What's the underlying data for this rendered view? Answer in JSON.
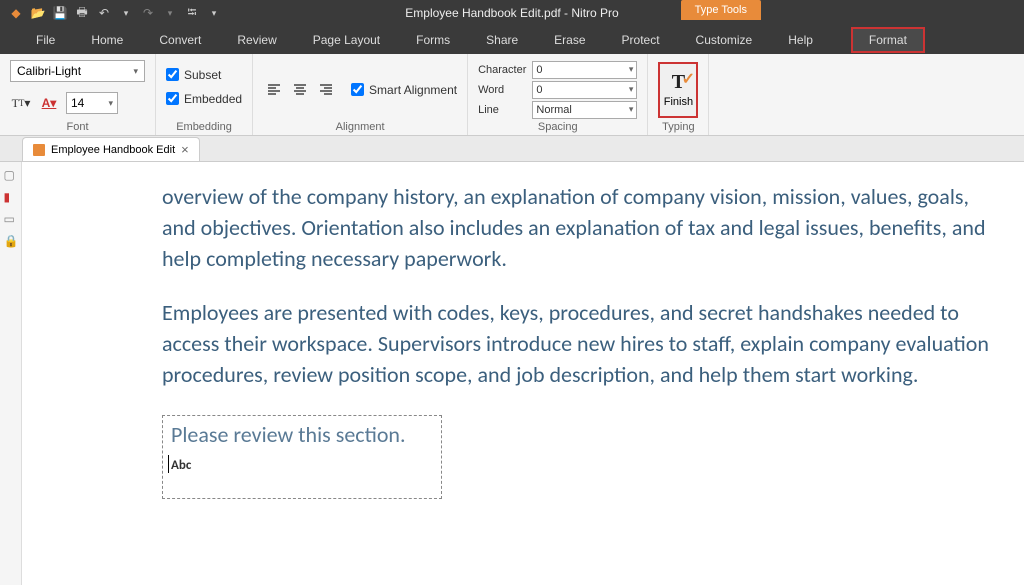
{
  "app": {
    "title": "Employee Handbook Edit.pdf - Nitro Pro",
    "tool_tab": "Type Tools"
  },
  "menu": {
    "file": "File",
    "home": "Home",
    "convert": "Convert",
    "review": "Review",
    "page_layout": "Page Layout",
    "forms": "Forms",
    "share": "Share",
    "erase": "Erase",
    "protect": "Protect",
    "customize": "Customize",
    "help": "Help",
    "format": "Format"
  },
  "ribbon": {
    "font": {
      "label": "Font",
      "family": "Calibri-Light",
      "size": "14"
    },
    "embedding": {
      "label": "Embedding",
      "subset": "Subset",
      "embedded": "Embedded"
    },
    "alignment": {
      "label": "Alignment",
      "smart": "Smart Alignment"
    },
    "spacing": {
      "label": "Spacing",
      "character_lbl": "Character",
      "character_val": "0",
      "word_lbl": "Word",
      "word_val": "0",
      "line_lbl": "Line",
      "line_val": "Normal"
    },
    "typing": {
      "label": "Typing",
      "finish": "Finish"
    }
  },
  "doc_tab": {
    "name": "Employee Handbook Edit"
  },
  "document": {
    "p1": "overview of the company history, an explanation of company vision, mission, values, goals, and objectives. Orientation also includes an explanation of tax and legal issues, benefits, and help completing necessary paperwork.",
    "p2": "Employees are presented with codes, keys, procedures, and secret handshakes needed to access their workspace. Supervisors introduce new hires to staff, explain company evaluation procedures, review position scope, and job description, and help them start working.",
    "edit_note": "Please review this section.",
    "cursor_hint": "Abc"
  }
}
